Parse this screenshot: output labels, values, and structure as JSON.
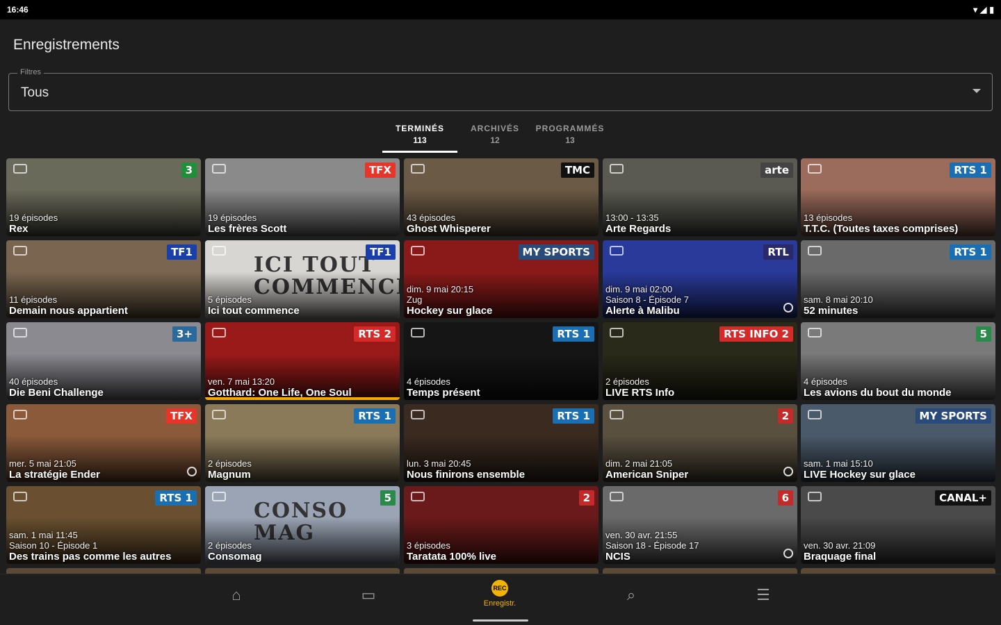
{
  "status": {
    "time": "16:46"
  },
  "header": {
    "title": "Enregistrements"
  },
  "filter": {
    "label": "Filtres",
    "value": "Tous"
  },
  "tabs": [
    {
      "label": "TERMINÉS",
      "count": "113",
      "active": true
    },
    {
      "label": "ARCHIVÉS",
      "count": "12",
      "active": false
    },
    {
      "label": "PROGRAMMÉS",
      "count": "13",
      "active": false
    }
  ],
  "cards": [
    {
      "lines": [
        "19 épisodes"
      ],
      "title": "Rex",
      "channel": "3",
      "logo_color": "#1f8f3a",
      "bg": "#6a6a5a"
    },
    {
      "lines": [
        "19 épisodes"
      ],
      "title": "Les frères Scott",
      "channel": "TFX",
      "logo_color": "#e8352a",
      "bg": "#8a8a8a"
    },
    {
      "lines": [
        "43 épisodes"
      ],
      "title": "Ghost Whisperer",
      "channel": "TMC",
      "logo_color": "#111111",
      "bg": "#6b5a45"
    },
    {
      "lines": [
        "13:00 - 13:35"
      ],
      "title": "Arte Regards",
      "channel": "arte",
      "logo_color": "#444444",
      "bg": "#5a5a52"
    },
    {
      "lines": [
        "13 épisodes"
      ],
      "title": "T.T.C. (Toutes taxes comprises)",
      "channel": "RTS 1",
      "logo_color": "#1a6fb3",
      "bg": "#9b6b5b"
    },
    {
      "lines": [
        "11 épisodes"
      ],
      "title": "Demain nous appartient",
      "channel": "TF1",
      "logo_color": "#1a3fa8",
      "bg": "#7a6650"
    },
    {
      "lines": [
        "5 épisodes"
      ],
      "title": "Ici tout commence",
      "channel": "TF1",
      "logo_color": "#1a3fa8",
      "bg": "#d8d6d2",
      "big": "ICI TOUT COMMENCE"
    },
    {
      "lines": [
        "dim. 9 mai 20:15",
        "Zug"
      ],
      "title": "Hockey sur glace",
      "channel": "MY SPORTS",
      "logo_color": "#2a4a7a",
      "bg": "#8a1a1a"
    },
    {
      "lines": [
        "dim. 9 mai 02:00",
        "Saison 8 - Épisode 7"
      ],
      "title": "Alerte à Malibu",
      "channel": "RTL",
      "logo_color": "#2a2a6a",
      "bg": "#2a3a9a",
      "clock": true
    },
    {
      "lines": [
        "sam. 8 mai 20:10"
      ],
      "title": "52 minutes",
      "channel": "RTS 1",
      "logo_color": "#1a6fb3",
      "bg": "#6a6a6a"
    },
    {
      "lines": [
        "40 épisodes"
      ],
      "title": "Die Beni Challenge",
      "channel": "3+",
      "logo_color": "#2a6a9a",
      "bg": "#8a8a90"
    },
    {
      "lines": [
        "ven. 7 mai 13:20"
      ],
      "title": "Gotthard: One Life, One Soul",
      "channel": "RTS 2",
      "logo_color": "#d42a2a",
      "bg": "#9a1a1a",
      "progress": 100
    },
    {
      "lines": [
        "4 épisodes"
      ],
      "title": "Temps présent",
      "channel": "RTS 1",
      "logo_color": "#1a6fb3",
      "bg": "#151515"
    },
    {
      "lines": [
        "2 épisodes"
      ],
      "title": "LIVE RTS Info",
      "channel": "RTS INFO 2",
      "logo_color": "#d42a2a",
      "bg": "#2a2a1a"
    },
    {
      "lines": [
        "4 épisodes"
      ],
      "title": "Les avions du bout du monde",
      "channel": "5",
      "logo_color": "#2a8a4a",
      "bg": "#7a7a7a"
    },
    {
      "lines": [
        "mer. 5 mai 21:05"
      ],
      "title": "La stratégie Ender",
      "channel": "TFX",
      "logo_color": "#e8352a",
      "bg": "#8a5a3a",
      "clock": true
    },
    {
      "lines": [
        "2 épisodes"
      ],
      "title": "Magnum",
      "channel": "RTS 1",
      "logo_color": "#1a6fb3",
      "bg": "#8a7a5a"
    },
    {
      "lines": [
        "lun. 3 mai 20:45"
      ],
      "title": "Nous finirons ensemble",
      "channel": "RTS 1",
      "logo_color": "#1a6fb3",
      "bg": "#3a2a20"
    },
    {
      "lines": [
        "dim. 2 mai 21:05"
      ],
      "title": "American Sniper",
      "channel": "2",
      "logo_color": "#c42a2a",
      "bg": "#5a5040",
      "clock": true
    },
    {
      "lines": [
        "sam. 1 mai 15:10"
      ],
      "title": "LIVE Hockey sur glace",
      "channel": "MY SPORTS",
      "logo_color": "#2a4a7a",
      "bg": "#4a5a6a"
    },
    {
      "lines": [
        "sam. 1 mai 11:45",
        "Saison 10 - Épisode 1"
      ],
      "title": "Des trains pas comme les autres",
      "channel": "RTS 1",
      "logo_color": "#1a6fb3",
      "bg": "#6a5030"
    },
    {
      "lines": [
        "2 épisodes"
      ],
      "title": "Consomag",
      "channel": "5",
      "logo_color": "#2a8a4a",
      "bg": "#9aa4b4",
      "big": "CONSO MAG"
    },
    {
      "lines": [
        "3 épisodes"
      ],
      "title": "Taratata 100% live",
      "channel": "2",
      "logo_color": "#c42a2a",
      "bg": "#6a1a1a"
    },
    {
      "lines": [
        "ven. 30 avr. 21:55",
        "Saison 18 - Épisode 17"
      ],
      "title": "NCIS",
      "channel": "6",
      "logo_color": "#c42a2a",
      "bg": "#6a6a6a",
      "clock": true
    },
    {
      "lines": [
        "ven. 30 avr. 21:09"
      ],
      "title": "Braquage final",
      "channel": "CANAL+",
      "logo_color": "#111111",
      "bg": "#4a4a4a"
    }
  ],
  "nav": [
    {
      "label": "",
      "icon": "home-icon",
      "glyph": "⌂",
      "active": false
    },
    {
      "label": "",
      "icon": "tv-guide-icon",
      "glyph": "▭",
      "active": false
    },
    {
      "label": "Enregistr.",
      "icon": "recordings-icon",
      "glyph": "REC",
      "active": true
    },
    {
      "label": "",
      "icon": "search-icon",
      "glyph": "⌕",
      "active": false
    },
    {
      "label": "",
      "icon": "menu-icon",
      "glyph": "☰",
      "active": false
    }
  ]
}
